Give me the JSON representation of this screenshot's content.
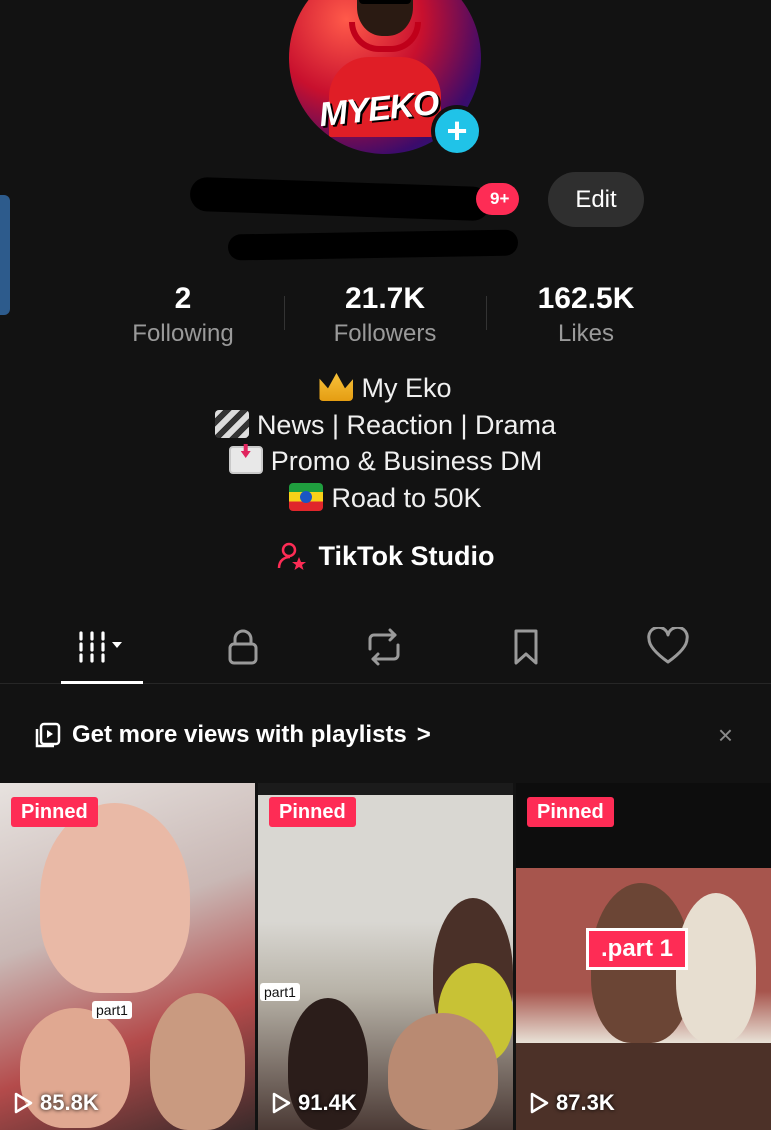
{
  "profile": {
    "avatar_text": "MYEKO",
    "age_badge": "9+",
    "edit_label": "Edit"
  },
  "stats": [
    {
      "value": "2",
      "label": "Following"
    },
    {
      "value": "21.7K",
      "label": "Followers"
    },
    {
      "value": "162.5K",
      "label": "Likes"
    }
  ],
  "bio": [
    {
      "icon": "crown-icon",
      "text": "My Eko"
    },
    {
      "icon": "clapperboard-icon",
      "text": "News | Reaction | Drama"
    },
    {
      "icon": "incoming-envelope-icon",
      "text": "Promo & Business DM"
    },
    {
      "icon": "ethiopia-flag-icon",
      "text": "Road to 50K"
    }
  ],
  "studio_label": "TikTok Studio",
  "tabs": [
    {
      "icon": "videos-grid-icon",
      "active": true
    },
    {
      "icon": "lock-icon",
      "active": false
    },
    {
      "icon": "repost-icon",
      "active": false
    },
    {
      "icon": "bookmark-icon",
      "active": false
    },
    {
      "icon": "heart-icon",
      "active": false
    }
  ],
  "banner": {
    "text": "Get more views with playlists",
    "chevron": ">",
    "close": "×"
  },
  "videos": [
    {
      "badge": "Pinned",
      "views": "85.8K",
      "overlay": "part1"
    },
    {
      "badge": "Pinned",
      "views": "91.4K",
      "overlay": "part1"
    },
    {
      "badge": "Pinned",
      "views": "87.3K",
      "overlay": ".part 1"
    }
  ],
  "colors": {
    "background": "#121212",
    "accent": "#fe2c55",
    "add_button": "#20c3e8"
  }
}
